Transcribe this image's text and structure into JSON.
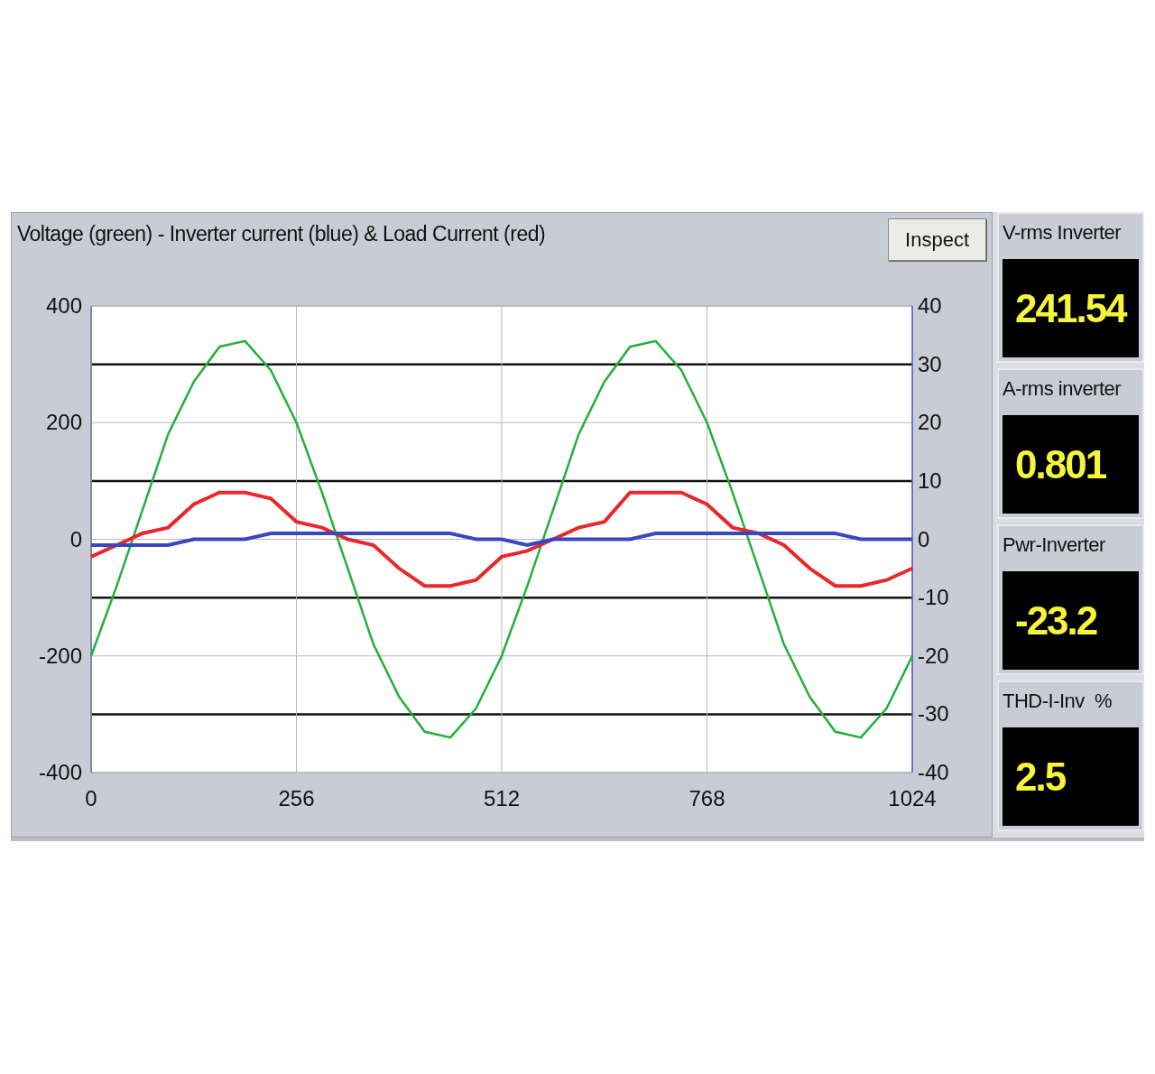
{
  "panel": {
    "title": "Voltage (green) - Inverter current (blue) & Load Current (red)",
    "button": "Inspect"
  },
  "chart_data": {
    "type": "line",
    "grid": true,
    "xlim": [
      0,
      1024
    ],
    "ylim": [
      -400,
      400
    ],
    "y2lim": [
      -40,
      40
    ],
    "xticks": [
      0,
      256,
      512,
      768,
      1024
    ],
    "yticks": [
      -400,
      -200,
      0,
      200,
      400
    ],
    "y2ticks": [
      -40,
      -30,
      -20,
      -10,
      0,
      10,
      20,
      30,
      40
    ],
    "x": [
      0,
      32,
      64,
      96,
      128,
      160,
      192,
      224,
      256,
      288,
      320,
      352,
      384,
      416,
      448,
      480,
      512,
      544,
      576,
      608,
      640,
      672,
      704,
      736,
      768,
      800,
      832,
      864,
      896,
      928,
      960,
      992,
      1024
    ],
    "series": [
      {
        "color": "#22b03a",
        "values": [
          -200,
          -80,
          50,
          180,
          270,
          330,
          340,
          290,
          200,
          80,
          -50,
          -180,
          -270,
          -330,
          -340,
          -290,
          -200,
          -80,
          50,
          180,
          270,
          330,
          340,
          290,
          200,
          80,
          -50,
          -180,
          -270,
          -330,
          -340,
          -290,
          -200
        ]
      },
      {
        "axis": "y2",
        "color": "#e8282a",
        "values": [
          -3,
          -1,
          1,
          2,
          6,
          8,
          8,
          7,
          3,
          2,
          0,
          -1,
          -5,
          -8,
          -8,
          -7,
          -3,
          -2,
          0,
          2,
          3,
          8,
          8,
          8,
          6,
          2,
          1,
          -1,
          -5,
          -8,
          -8,
          -7,
          -5
        ]
      },
      {
        "axis": "y2",
        "color": "#3a45c0",
        "values": [
          -1,
          -1,
          -1,
          -1,
          0,
          0,
          0,
          1,
          1,
          1,
          1,
          1,
          1,
          1,
          1,
          0,
          0,
          -1,
          0,
          0,
          0,
          0,
          1,
          1,
          1,
          1,
          1,
          1,
          1,
          1,
          0,
          0,
          0
        ]
      }
    ]
  },
  "meters": [
    {
      "label": "V-rms Inverter",
      "value": "241.54"
    },
    {
      "label": "A-rms inverter",
      "value": "0.801"
    },
    {
      "label": "Pwr-Inverter",
      "value": "-23.2"
    },
    {
      "label": "THD-I-Inv  %",
      "value": "2.5"
    }
  ]
}
